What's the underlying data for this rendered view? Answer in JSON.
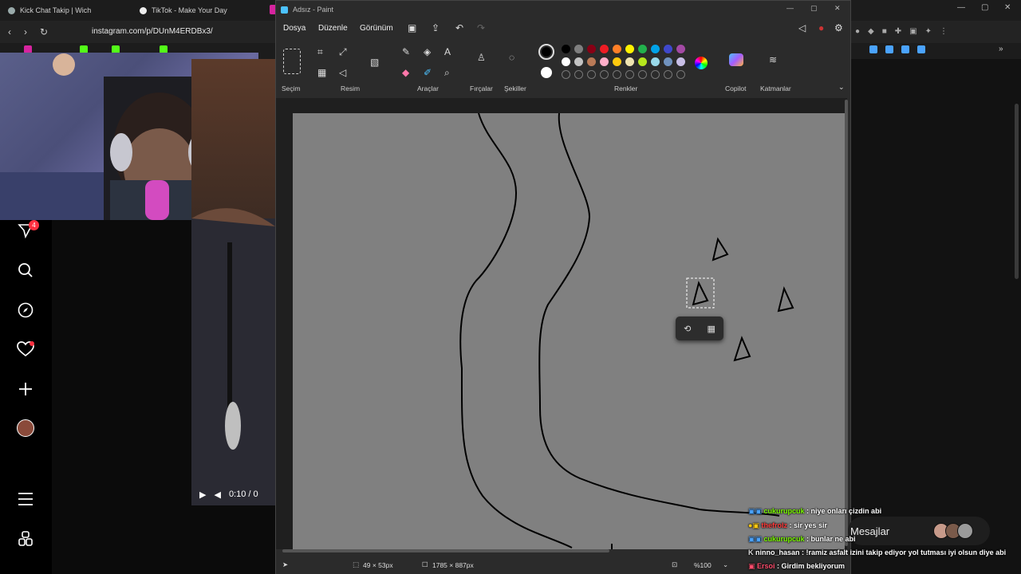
{
  "browser": {
    "tabs": [
      "Kick Chat Takip | Wich",
      "TikTok - Make Your Day"
    ],
    "url": "instagram.com/p/DUnM4ERDBx3/"
  },
  "instagram": {
    "notifications_count": "4",
    "video_time": "0:10 / 0"
  },
  "paint": {
    "title": "Adsız - Paint",
    "menu": [
      "Dosya",
      "Düzenle",
      "Görünüm"
    ],
    "groups": {
      "selection": "Seçim",
      "image": "Resim",
      "tools": "Araçlar",
      "brushes": "Fırçalar",
      "shapes": "Şekiller",
      "colors": "Renkler",
      "copilot": "Copilot",
      "layers": "Katmanlar"
    },
    "palette_row1": [
      "#000000",
      "#7f7f7f",
      "#880015",
      "#ed1c24",
      "#ff7f27",
      "#fff200",
      "#22b14c",
      "#00a2e8",
      "#3f48cc",
      "#a349a4"
    ],
    "palette_row2": [
      "#ffffff",
      "#c3c3c3",
      "#b97a57",
      "#ffaec9",
      "#ffc90e",
      "#efe4b0",
      "#b5e61d",
      "#99d9ea",
      "#7092be",
      "#c8bfe7"
    ],
    "primary_color": "#000000",
    "secondary_color": "#ffffff",
    "canvas_color": "#808080",
    "status": {
      "selection_size": "49 × 53px",
      "canvas_size": "1785 × 887px",
      "zoom": "%100"
    }
  },
  "chat": [
    {
      "user": "cukurupcuk",
      "color": "#7cfc00",
      "message": " : niye onları çizdin abi"
    },
    {
      "user": "thefrolz",
      "color": "#ff3b3b",
      "message": " : sir yes sir"
    },
    {
      "user": "cukurupcuk",
      "color": "#7cfc00",
      "message": " : bunlar ne abi"
    },
    {
      "user": "ninno_hasan",
      "color": "#ffffff",
      "message": " : !ramiz asfalt izini takip ediyor yol tutması iyi olsun diye abi"
    },
    {
      "user": "Ersoi",
      "color": "#ff4d6d",
      "message": " : Girdim bekliyorum"
    }
  ],
  "messages_label": "Mesajlar"
}
